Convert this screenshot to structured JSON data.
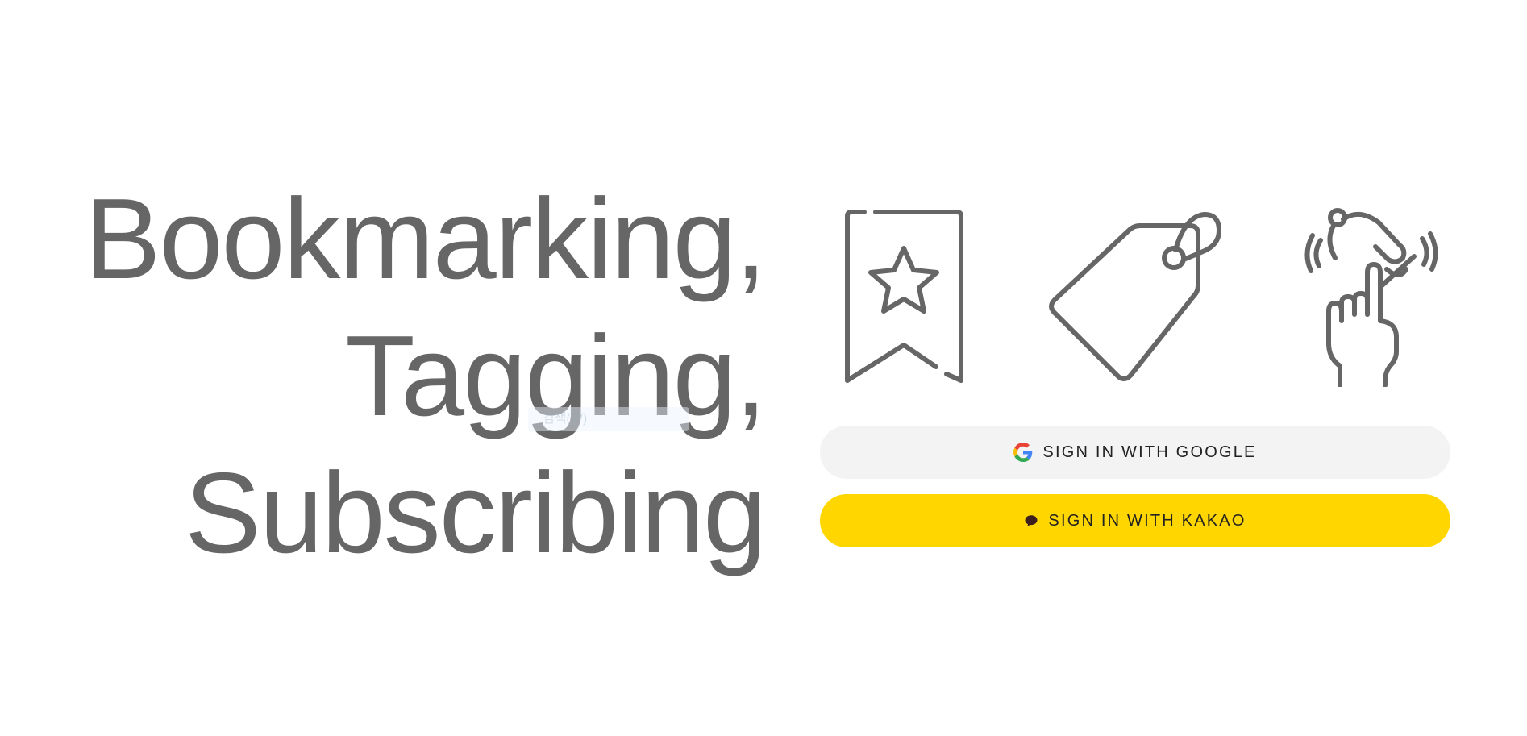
{
  "headline": {
    "line1": "Bookmarking,",
    "line2": "Tagging,",
    "line3": "Subscribing"
  },
  "ghost_label": "검색(W)",
  "icons": {
    "bookmark": "bookmark-star-icon",
    "tag": "price-tag-icon",
    "subscribe": "ringing-bell-tap-icon"
  },
  "auth": {
    "google_label": "SIGN IN WITH GOOGLE",
    "kakao_label": "SIGN IN WITH KAKAO"
  },
  "colors": {
    "text": "#666666",
    "google_button_bg": "#f3f3f3",
    "kakao_button_bg": "#ffd600",
    "button_text": "#222222"
  }
}
